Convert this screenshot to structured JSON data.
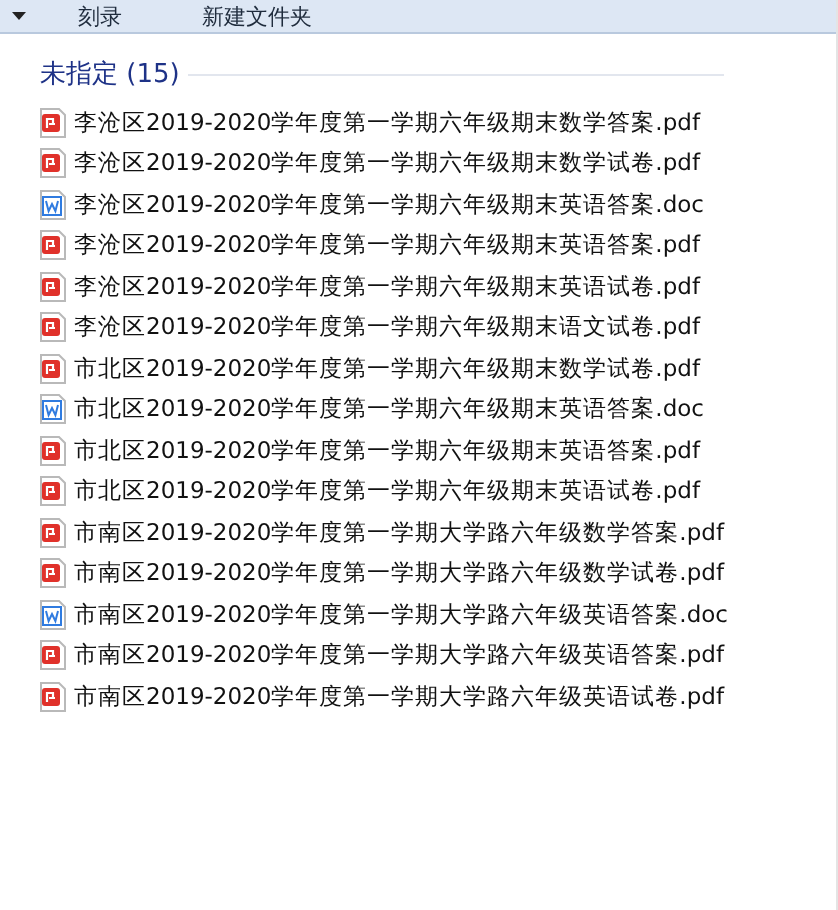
{
  "toolbar": {
    "buttons": [
      "刻录",
      "新建文件夹"
    ]
  },
  "group": {
    "title": "未指定 (15)",
    "files": [
      {
        "name": "李沧区2019-2020学年度第一学期六年级期末数学答案.pdf",
        "kind": "pdf"
      },
      {
        "name": "李沧区2019-2020学年度第一学期六年级期末数学试卷.pdf",
        "kind": "pdf"
      },
      {
        "name": "李沧区2019-2020学年度第一学期六年级期末英语答案.doc",
        "kind": "doc"
      },
      {
        "name": "李沧区2019-2020学年度第一学期六年级期末英语答案.pdf",
        "kind": "pdf"
      },
      {
        "name": "李沧区2019-2020学年度第一学期六年级期末英语试卷.pdf",
        "kind": "pdf"
      },
      {
        "name": "李沧区2019-2020学年度第一学期六年级期末语文试卷.pdf",
        "kind": "pdf"
      },
      {
        "name": "市北区2019-2020学年度第一学期六年级期末数学试卷.pdf",
        "kind": "pdf"
      },
      {
        "name": "市北区2019-2020学年度第一学期六年级期末英语答案.doc",
        "kind": "doc"
      },
      {
        "name": "市北区2019-2020学年度第一学期六年级期末英语答案.pdf",
        "kind": "pdf"
      },
      {
        "name": "市北区2019-2020学年度第一学期六年级期末英语试卷.pdf",
        "kind": "pdf"
      },
      {
        "name": "市南区2019-2020学年度第一学期大学路六年级数学答案.pdf",
        "kind": "pdf"
      },
      {
        "name": "市南区2019-2020学年度第一学期大学路六年级数学试卷.pdf",
        "kind": "pdf"
      },
      {
        "name": "市南区2019-2020学年度第一学期大学路六年级英语答案.doc",
        "kind": "doc"
      },
      {
        "name": "市南区2019-2020学年度第一学期大学路六年级英语答案.pdf",
        "kind": "pdf"
      },
      {
        "name": "市南区2019-2020学年度第一学期大学路六年级英语试卷.pdf",
        "kind": "pdf"
      }
    ]
  }
}
